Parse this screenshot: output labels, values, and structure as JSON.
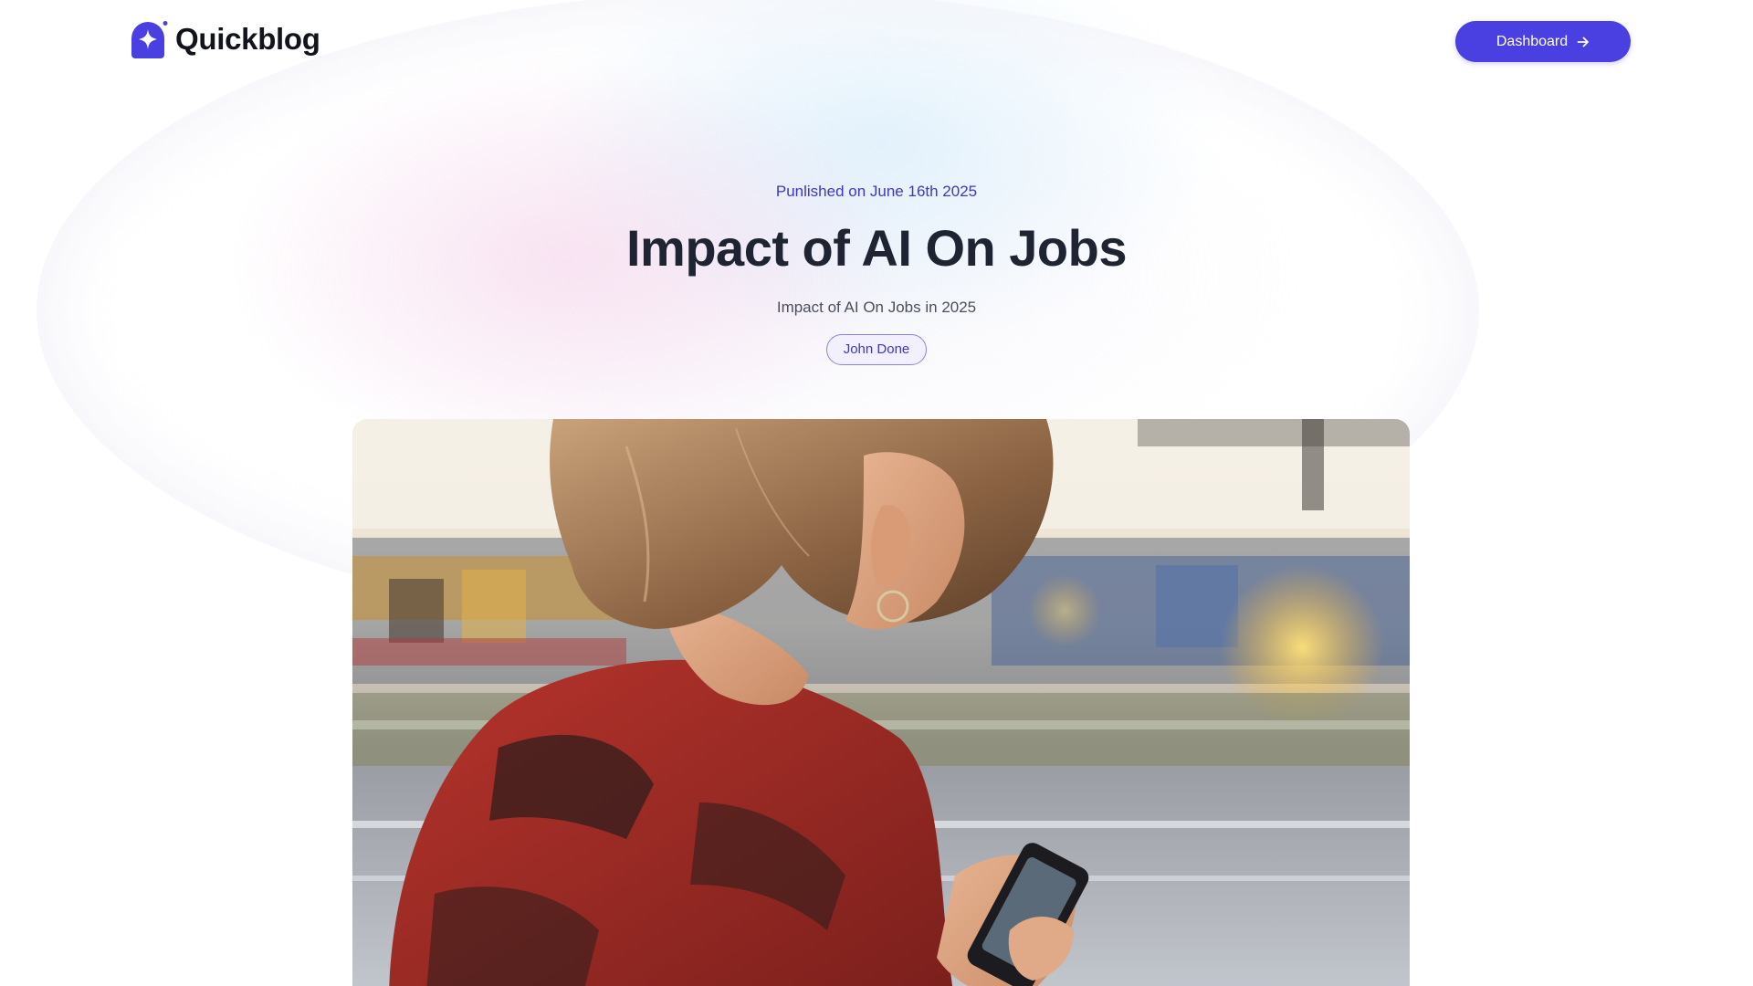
{
  "header": {
    "logo_text": "Quickblog",
    "logo_icon": "sparkle-house-icon",
    "dashboard_label": "Dashboard",
    "dashboard_icon": "arrow-right-icon"
  },
  "article": {
    "published": "Punlished on June 16th 2025",
    "title": "Impact of AI On Jobs",
    "subtitle": "Impact of AI On Jobs in 2025",
    "author": "John Done"
  },
  "colors": {
    "accent": "#4a3fe0",
    "accent_text": "#3f36c9",
    "heading": "#1f2433"
  }
}
